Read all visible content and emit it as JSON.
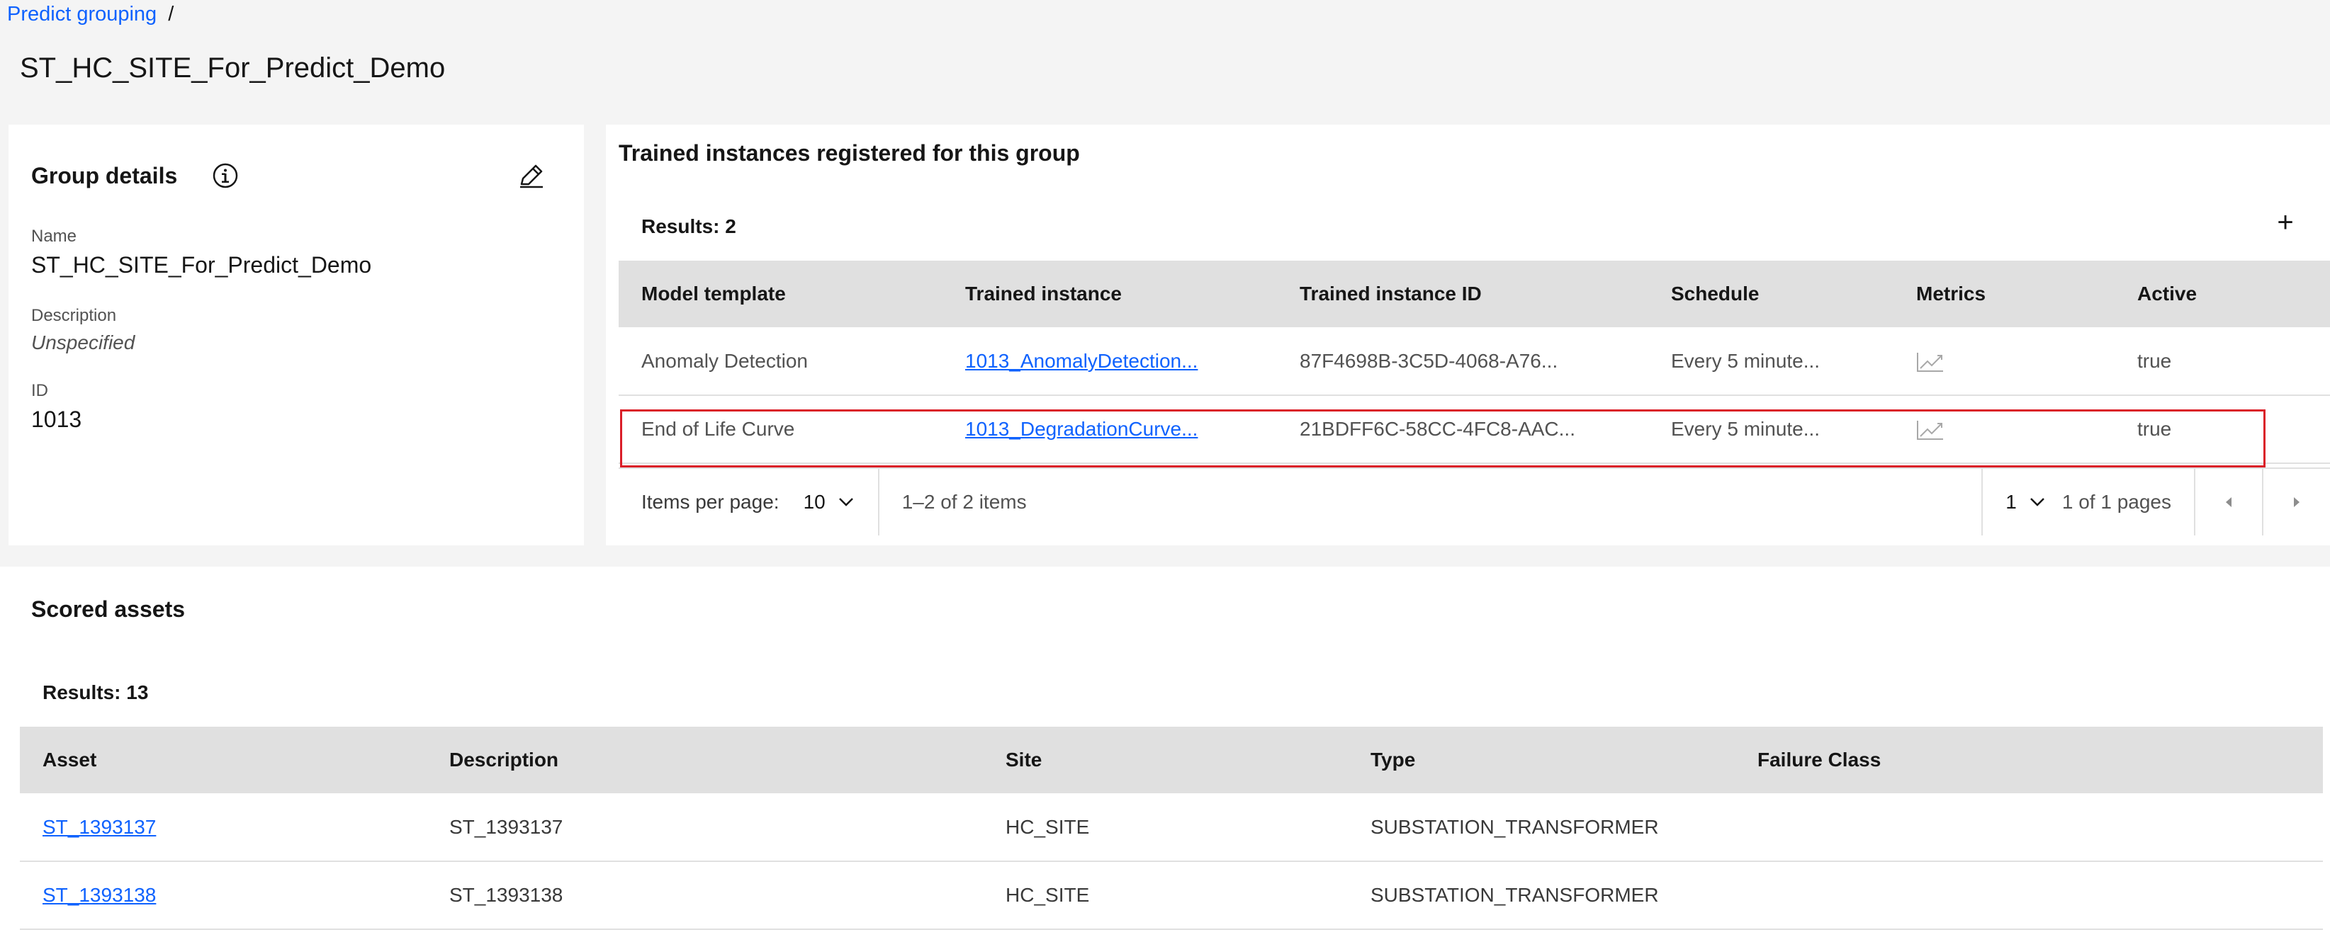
{
  "breadcrumb": {
    "link": "Predict grouping",
    "separator": "/"
  },
  "page_title": "ST_HC_SITE_For_Predict_Demo",
  "group_details": {
    "heading": "Group details",
    "fields": [
      {
        "label": "Name",
        "value": "ST_HC_SITE_For_Predict_Demo"
      },
      {
        "label": "Description",
        "value": "Unspecified"
      },
      {
        "label": "ID",
        "value": "1013"
      }
    ]
  },
  "trained_instances": {
    "heading": "Trained instances registered for this group",
    "results": "Results: 2",
    "add_label": "+",
    "columns": [
      "Model template",
      "Trained instance",
      "Trained instance ID",
      "Schedule",
      "Metrics",
      "Active"
    ],
    "rows": [
      {
        "model_template": "Anomaly Detection",
        "trained_instance": "1013_AnomalyDetection...",
        "instance_id": "87F4698B-3C5D-4068-A76...",
        "schedule": "Every 5 minute...",
        "metrics_icon": "chart-line-icon",
        "active": "true"
      },
      {
        "model_template": "End of Life Curve",
        "trained_instance": "1013_DegradationCurve...",
        "instance_id": "21BDFF6C-58CC-4FC8-AAC...",
        "schedule": "Every 5 minute...",
        "metrics_icon": "chart-line-icon",
        "active": "true"
      }
    ],
    "pagination": {
      "items_per_page_label": "Items per page:",
      "items_per_page": "10",
      "range": "1–2 of 2 items",
      "page": "1",
      "page_of": "1 of 1 pages"
    }
  },
  "scored_assets": {
    "heading": "Scored assets",
    "results": "Results: 13",
    "columns": [
      "Asset",
      "Description",
      "Site",
      "Type",
      "Failure Class"
    ],
    "rows": [
      {
        "asset": "ST_1393137",
        "description": "ST_1393137",
        "site": "HC_SITE",
        "type": "SUBSTATION_TRANSFORMER",
        "failure_class": ""
      },
      {
        "asset": "ST_1393138",
        "description": "ST_1393138",
        "site": "HC_SITE",
        "type": "SUBSTATION_TRANSFORMER",
        "failure_class": ""
      }
    ]
  },
  "colors": {
    "link": "#0f62fe",
    "highlight": "#da1e28",
    "header_bg": "#e0e0e0",
    "page_bg": "#f4f4f4"
  }
}
